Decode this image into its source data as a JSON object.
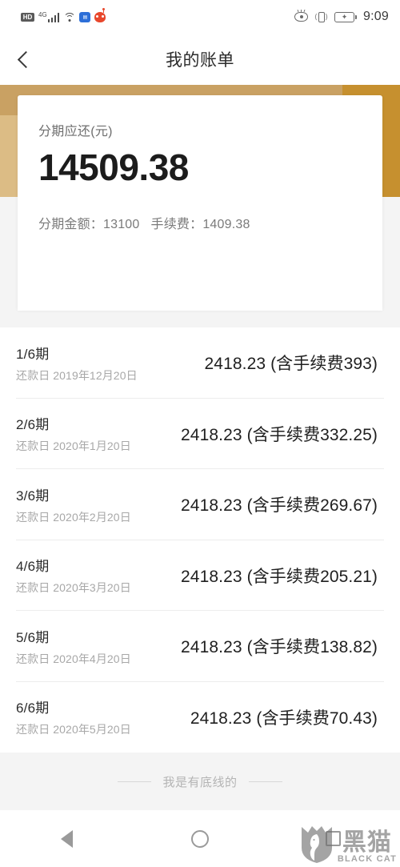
{
  "status_bar": {
    "hd_badge": "HD",
    "network_type": "4G",
    "icons": [
      "hd-badge",
      "signal-bars-icon",
      "wifi-icon",
      "app-badge-blue-icon",
      "app-badge-red-icon",
      "eye-care-icon",
      "vibrate-icon",
      "battery-charging-icon"
    ],
    "time": "9:09"
  },
  "header": {
    "back_icon": "chevron-left-icon",
    "title": "我的账单"
  },
  "summary_card": {
    "label": "分期应还(元)",
    "amount": "14509.38",
    "principal_label": "分期金额：",
    "principal_value": "13100",
    "fee_label": "手续费：",
    "fee_value": "1409.38"
  },
  "installments": [
    {
      "term": "1/6期",
      "date": "还款日 2019年12月20日",
      "amount": "2418.23 (含手续费393)"
    },
    {
      "term": "2/6期",
      "date": "还款日 2020年1月20日",
      "amount": "2418.23 (含手续费332.25)"
    },
    {
      "term": "3/6期",
      "date": "还款日 2020年2月20日",
      "amount": "2418.23 (含手续费269.67)"
    },
    {
      "term": "4/6期",
      "date": "还款日 2020年3月20日",
      "amount": "2418.23 (含手续费205.21)"
    },
    {
      "term": "5/6期",
      "date": "还款日 2020年4月20日",
      "amount": "2418.23 (含手续费138.82)"
    },
    {
      "term": "6/6期",
      "date": "还款日 2020年5月20日",
      "amount": "2418.23 (含手续费70.43)"
    }
  ],
  "footer": {
    "end_of_list": "我是有底线的"
  },
  "nav_bar": {
    "back": "back-triangle-icon",
    "home": "home-circle-icon",
    "recents": "recents-square-icon"
  },
  "watermark": {
    "cn": "黑猫",
    "en": "BLACK CAT"
  },
  "colors": {
    "gold_dark": "#c9a163",
    "gold_amber": "#c6902f",
    "gold_tan": "#dcbc85",
    "page_bg": "#f4f4f4",
    "card_bg": "#ffffff",
    "text_primary": "#1f1f1f",
    "text_muted": "#a8a8a8"
  }
}
